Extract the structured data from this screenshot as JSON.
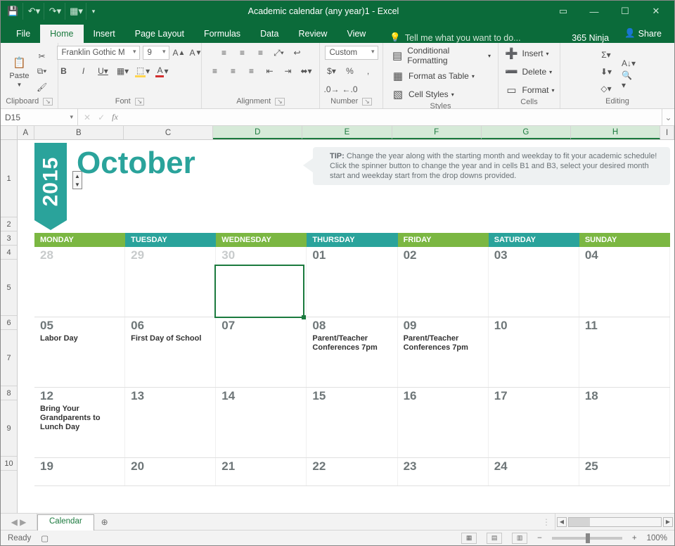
{
  "titlebar": {
    "title": "Academic calendar (any year)1 - Excel"
  },
  "menutabs": {
    "file": "File",
    "home": "Home",
    "insert": "Insert",
    "pagelayout": "Page Layout",
    "formulas": "Formulas",
    "data": "Data",
    "review": "Review",
    "view": "View",
    "tellme": "Tell me what you want to do...",
    "ninja": "365 Ninja",
    "share": "Share"
  },
  "ribbon": {
    "clipboard": {
      "paste": "Paste",
      "label": "Clipboard"
    },
    "font": {
      "name": "Franklin Gothic M",
      "size": "9",
      "label": "Font"
    },
    "alignment": {
      "label": "Alignment"
    },
    "number": {
      "format": "Custom",
      "label": "Number"
    },
    "styles": {
      "cond": "Conditional Formatting",
      "table": "Format as Table",
      "cells": "Cell Styles",
      "label": "Styles"
    },
    "cells": {
      "insert": "Insert",
      "delete": "Delete",
      "format": "Format",
      "label": "Cells"
    },
    "editing": {
      "label": "Editing"
    }
  },
  "namebox": "D15",
  "columns": [
    "A",
    "B",
    "C",
    "D",
    "E",
    "F",
    "G",
    "H",
    "I"
  ],
  "rows": [
    "1",
    "2",
    "3",
    "4",
    "5",
    "6",
    "7",
    "8",
    "9",
    "10"
  ],
  "calendar": {
    "year": "2015",
    "month": "October",
    "tip": "Change the year along with the starting month and weekday to fit your academic schedule! Click the spinner button to change the year and in cells B1 and B3, select your desired month start and weekday start from the drop downs provided.",
    "days": [
      "MONDAY",
      "TUESDAY",
      "WEDNESDAY",
      "THURSDAY",
      "FRIDAY",
      "SATURDAY",
      "SUNDAY"
    ],
    "weeks": [
      [
        {
          "n": "28",
          "dim": true
        },
        {
          "n": "29",
          "dim": true
        },
        {
          "n": "30",
          "dim": true
        },
        {
          "n": "01"
        },
        {
          "n": "02"
        },
        {
          "n": "03"
        },
        {
          "n": "04"
        }
      ],
      [
        {
          "n": "05",
          "ev": "Labor Day"
        },
        {
          "n": "06",
          "ev": "First Day of School"
        },
        {
          "n": "07"
        },
        {
          "n": "08",
          "ev": "Parent/Teacher Conferences 7pm"
        },
        {
          "n": "09",
          "ev": "Parent/Teacher Conferences 7pm"
        },
        {
          "n": "10"
        },
        {
          "n": "11"
        }
      ],
      [
        {
          "n": "12",
          "ev": "Bring Your Grandparents to Lunch Day"
        },
        {
          "n": "13"
        },
        {
          "n": "14"
        },
        {
          "n": "15"
        },
        {
          "n": "16"
        },
        {
          "n": "17"
        },
        {
          "n": "18"
        }
      ],
      [
        {
          "n": "19"
        },
        {
          "n": "20"
        },
        {
          "n": "21"
        },
        {
          "n": "22"
        },
        {
          "n": "23"
        },
        {
          "n": "24"
        },
        {
          "n": "25"
        }
      ]
    ]
  },
  "sheettab": "Calendar",
  "status": {
    "ready": "Ready",
    "zoom": "100%"
  }
}
